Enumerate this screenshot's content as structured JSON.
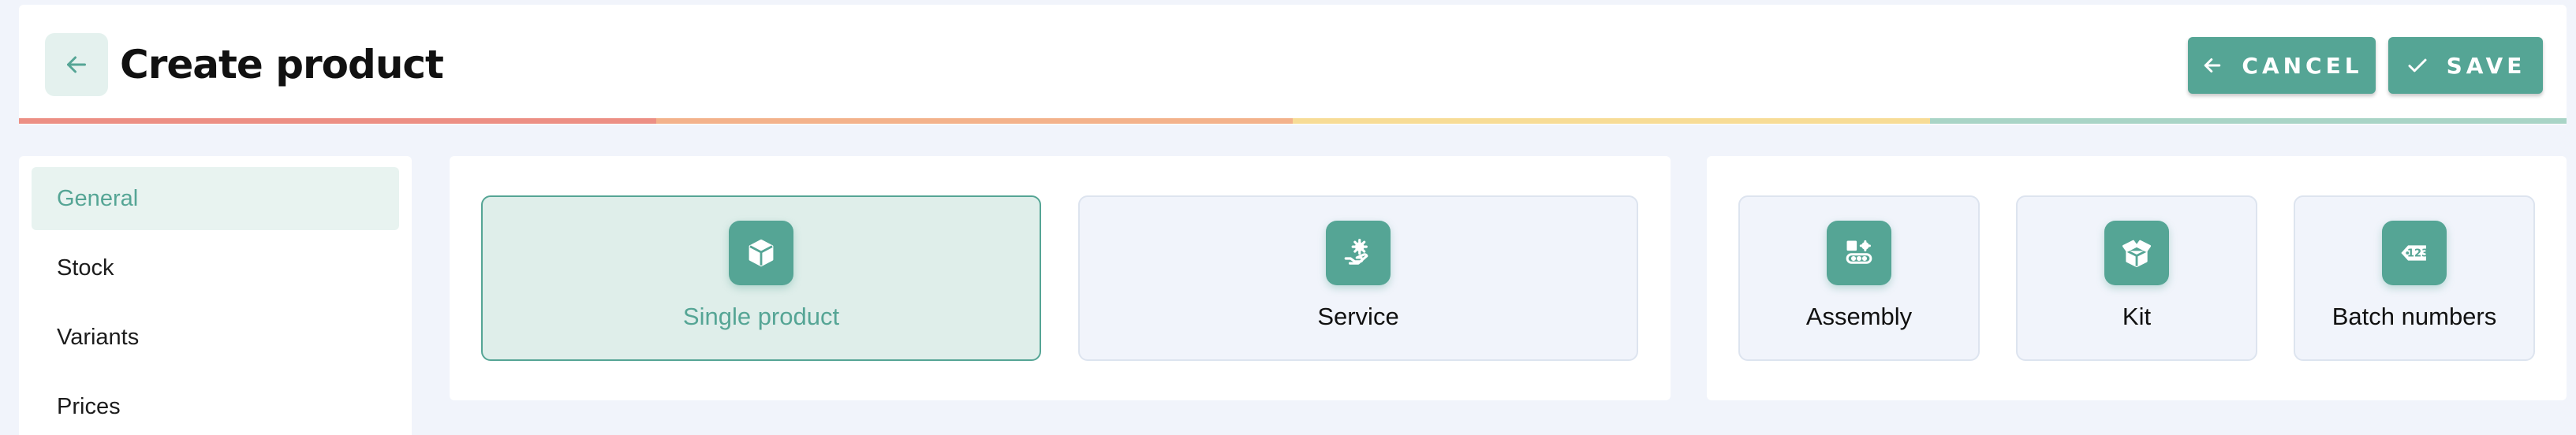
{
  "header": {
    "title": "Create product",
    "back_icon": "arrow-left-icon",
    "cancel_label": "CANCEL",
    "save_label": "SAVE"
  },
  "progress_colors": [
    "#ec8f84",
    "#f3b28b",
    "#f7dc96",
    "#a9d4c6"
  ],
  "sidebar": {
    "items": [
      {
        "label": "General",
        "active": true
      },
      {
        "label": "Stock",
        "active": false
      },
      {
        "label": "Variants",
        "active": false
      },
      {
        "label": "Prices",
        "active": false
      }
    ]
  },
  "product_types": [
    {
      "label": "Single product",
      "icon": "cube-icon",
      "selected": true
    },
    {
      "label": "Service",
      "icon": "service-gear-hand-icon",
      "selected": false
    }
  ],
  "product_options": [
    {
      "label": "Assembly",
      "icon": "assembly-icon"
    },
    {
      "label": "Kit",
      "icon": "kit-box-icon"
    },
    {
      "label": "Batch numbers",
      "icon": "batch-tag-icon"
    }
  ],
  "colors": {
    "accent": "#55a595",
    "accent_light": "#e8f3f0",
    "page_bg": "#f1f4fb"
  }
}
